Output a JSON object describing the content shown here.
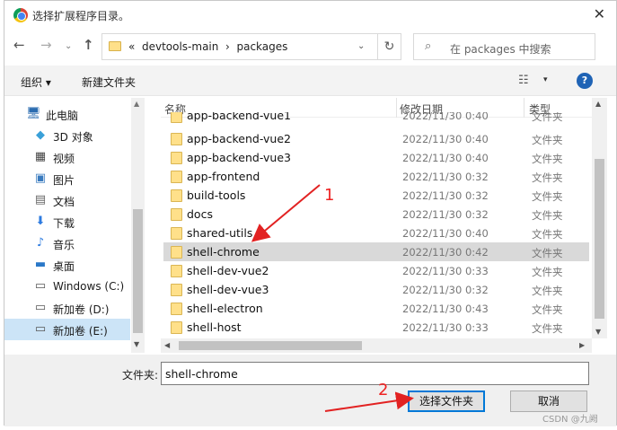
{
  "window": {
    "title": "选择扩展程序目录。",
    "close": "✕"
  },
  "nav": {
    "back": "←",
    "forward": "→",
    "dropdown": "⌄",
    "up": "↑"
  },
  "address": {
    "prefix": "«",
    "path": [
      "devtools-main",
      "packages"
    ],
    "separator": "›",
    "dropdown": "⌄",
    "refresh": "↻"
  },
  "search": {
    "placeholder": "在 packages 中搜索",
    "icon": "⌕"
  },
  "toolbar": {
    "organize": "组织 ▾",
    "new_folder": "新建文件夹",
    "view_icon": "☷",
    "view_dropdown": "▾",
    "help": "?"
  },
  "sidebar": {
    "items": [
      {
        "label": "此电脑",
        "icon": "🖥"
      },
      {
        "label": "3D 对象",
        "icon": "◆"
      },
      {
        "label": "视频",
        "icon": "▦"
      },
      {
        "label": "图片",
        "icon": "▣"
      },
      {
        "label": "文档",
        "icon": "▤"
      },
      {
        "label": "下载",
        "icon": "⬇"
      },
      {
        "label": "音乐",
        "icon": "♪"
      },
      {
        "label": "桌面",
        "icon": "▬"
      },
      {
        "label": "Windows (C:)",
        "icon": "▭"
      },
      {
        "label": "新加卷 (D:)",
        "icon": "▭"
      },
      {
        "label": "新加卷 (E:)",
        "icon": "▭"
      }
    ],
    "selected_index": 10
  },
  "columns": {
    "name": "名称",
    "date": "修改日期",
    "type": "类型"
  },
  "files": [
    {
      "name": "app-backend-vue1",
      "date": "2022/11/30 0:40",
      "type": "文件夹"
    },
    {
      "name": "app-backend-vue2",
      "date": "2022/11/30 0:40",
      "type": "文件夹"
    },
    {
      "name": "app-backend-vue3",
      "date": "2022/11/30 0:40",
      "type": "文件夹"
    },
    {
      "name": "app-frontend",
      "date": "2022/11/30 0:32",
      "type": "文件夹"
    },
    {
      "name": "build-tools",
      "date": "2022/11/30 0:32",
      "type": "文件夹"
    },
    {
      "name": "docs",
      "date": "2022/11/30 0:32",
      "type": "文件夹"
    },
    {
      "name": "shared-utils",
      "date": "2022/11/30 0:40",
      "type": "文件夹"
    },
    {
      "name": "shell-chrome",
      "date": "2022/11/30 0:42",
      "type": "文件夹"
    },
    {
      "name": "shell-dev-vue2",
      "date": "2022/11/30 0:33",
      "type": "文件夹"
    },
    {
      "name": "shell-dev-vue3",
      "date": "2022/11/30 0:32",
      "type": "文件夹"
    },
    {
      "name": "shell-electron",
      "date": "2022/11/30 0:43",
      "type": "文件夹"
    },
    {
      "name": "shell-host",
      "date": "2022/11/30 0:33",
      "type": "文件夹"
    }
  ],
  "selected_file_index": 7,
  "footer": {
    "folder_label": "文件夹:",
    "folder_value": "shell-chrome",
    "select_button": "选择文件夹",
    "cancel_button": "取消"
  },
  "annotations": {
    "marker_1": "1",
    "marker_2": "2",
    "color": "#e22222"
  },
  "watermark": "CSDN @九阙"
}
